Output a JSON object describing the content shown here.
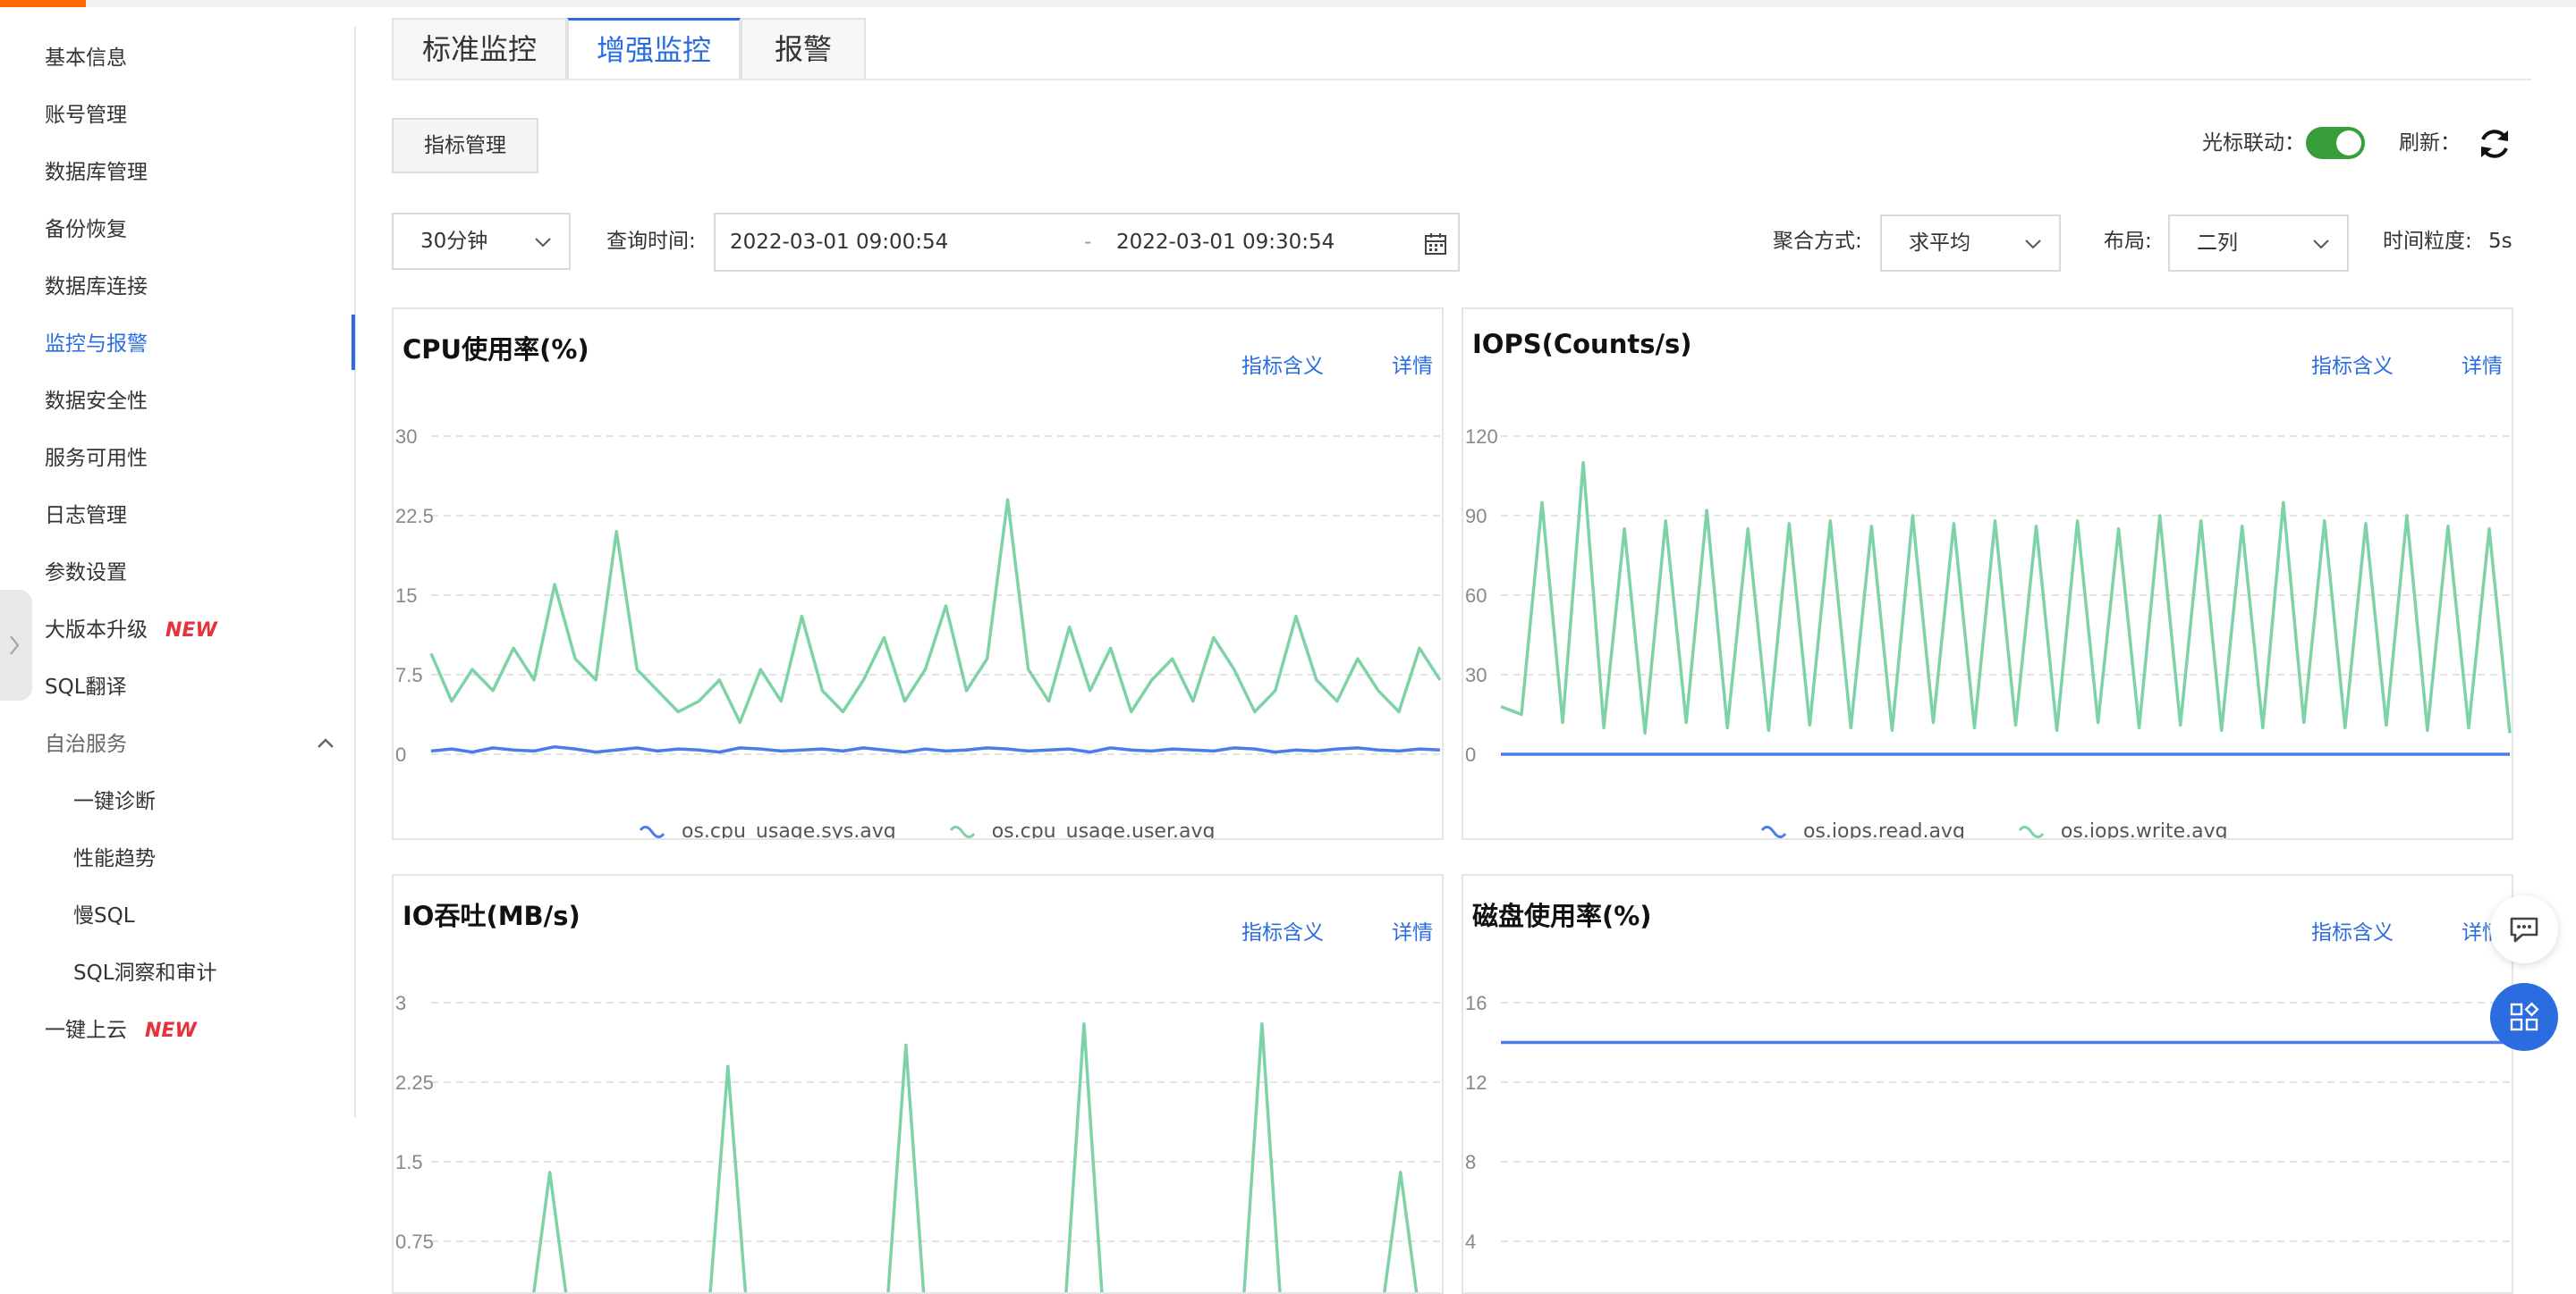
{
  "sidebar": {
    "items": [
      {
        "label": "基本信息"
      },
      {
        "label": "账号管理"
      },
      {
        "label": "数据库管理"
      },
      {
        "label": "备份恢复"
      },
      {
        "label": "数据库连接"
      },
      {
        "label": "监控与报警"
      },
      {
        "label": "数据安全性"
      },
      {
        "label": "服务可用性"
      },
      {
        "label": "日志管理"
      },
      {
        "label": "参数设置"
      },
      {
        "label": "大版本升级",
        "badge": "NEW"
      },
      {
        "label": "SQL翻译"
      },
      {
        "label": "自治服务"
      },
      {
        "label": "一键诊断"
      },
      {
        "label": "性能趋势"
      },
      {
        "label": "慢SQL"
      },
      {
        "label": "SQL洞察和审计"
      },
      {
        "label": "一键上云",
        "badge": "NEW"
      }
    ],
    "active_item": "监控与报警",
    "expanded_icon": "chevron-up-icon"
  },
  "tabs": [
    {
      "label": "标准监控"
    },
    {
      "label": "增强监控"
    },
    {
      "label": "报警"
    }
  ],
  "active_tab": "增强监控",
  "toolbar": {
    "metric_mgmt_label": "指标管理",
    "cursor_link_label": "光标联动：",
    "cursor_link_on": true,
    "refresh_label": "刷新：",
    "range_select": "30分钟",
    "query_time_label": "查询时间:",
    "start_time": "2022-03-01 09:00:54",
    "range_sep": "-",
    "end_time": "2022-03-01 09:30:54",
    "agg_label": "聚合方式:",
    "agg_value": "求平均",
    "layout_label": "布局:",
    "layout_value": "二列",
    "granularity_label": "时间粒度:",
    "granularity_value": "5s"
  },
  "colors": {
    "accent": "#2b6de0",
    "series_blue": "#4a7de8",
    "series_green": "#7dd3a5",
    "toggle_on": "#389e3a",
    "new_badge": "#e8313b",
    "top_accent": "#ff6a00"
  },
  "card_links": {
    "meaning": "指标含义",
    "detail": "详情"
  },
  "chart_data": [
    {
      "type": "line",
      "title": "CPU使用率(%)",
      "ylim": [
        0,
        30
      ],
      "yticks": [
        "0",
        "7.5",
        "15",
        "22.5",
        "30"
      ],
      "grid": true,
      "legend_position": "bottom",
      "series": [
        {
          "name": "os.cpu_usage.sys.avg",
          "color": "#4a7de8",
          "values": [
            0.3,
            0.5,
            0.2,
            0.6,
            0.4,
            0.3,
            0.7,
            0.5,
            0.2,
            0.4,
            0.6,
            0.3,
            0.5,
            0.4,
            0.2,
            0.6,
            0.5,
            0.3,
            0.4,
            0.5,
            0.3,
            0.6,
            0.4,
            0.2,
            0.5,
            0.3,
            0.4,
            0.6,
            0.5,
            0.3,
            0.4,
            0.5,
            0.2,
            0.6,
            0.4,
            0.3,
            0.5,
            0.4,
            0.3,
            0.6,
            0.5,
            0.2,
            0.4,
            0.3,
            0.5,
            0.6,
            0.4,
            0.3,
            0.5,
            0.4
          ]
        },
        {
          "name": "os.cpu_usage.user.avg",
          "color": "#7dd3a5",
          "values": [
            9.5,
            5,
            8,
            6,
            10,
            7,
            16,
            9,
            7,
            21,
            8,
            6,
            4,
            5,
            7,
            3,
            8,
            5,
            13,
            6,
            4,
            7,
            11,
            5,
            8,
            14,
            6,
            9,
            24,
            8,
            5,
            12,
            6,
            10,
            4,
            7,
            9,
            5,
            11,
            8,
            4,
            6,
            13,
            7,
            5,
            9,
            6,
            4,
            10,
            7
          ]
        }
      ]
    },
    {
      "type": "line",
      "title": "IOPS(Counts/s)",
      "ylim": [
        0,
        120
      ],
      "yticks": [
        "0",
        "30",
        "60",
        "90",
        "120"
      ],
      "grid": true,
      "legend_position": "bottom",
      "series": [
        {
          "name": "os.iops.read.avg",
          "color": "#4a7de8",
          "values": [
            0,
            0,
            0,
            0,
            0,
            0,
            0,
            0,
            0,
            0,
            0,
            0,
            0,
            0,
            0,
            0,
            0,
            0,
            0,
            0,
            0,
            0,
            0,
            0,
            0,
            0,
            0,
            0,
            0,
            0,
            0,
            0,
            0,
            0,
            0,
            0,
            0,
            0,
            0,
            0,
            0,
            0,
            0,
            0,
            0,
            0,
            0,
            0,
            0,
            0
          ]
        },
        {
          "name": "os.iops.write.avg",
          "color": "#7dd3a5",
          "values": [
            18,
            15,
            95,
            12,
            110,
            10,
            85,
            8,
            88,
            12,
            92,
            10,
            85,
            9,
            87,
            11,
            88,
            10,
            86,
            9,
            90,
            12,
            87,
            10,
            88,
            11,
            86,
            9,
            88,
            12,
            85,
            10,
            90,
            11,
            88,
            9,
            86,
            10,
            95,
            12,
            88,
            10,
            87,
            11,
            90,
            9,
            86,
            10,
            85,
            8
          ]
        }
      ]
    },
    {
      "type": "line",
      "title": "IO吞吐(MB/s)",
      "ylim": [
        0,
        3
      ],
      "yticks": [
        "0.75",
        "1.5",
        "2.25",
        "3"
      ],
      "grid": true,
      "series": [
        {
          "name": "",
          "color": "#7dd3a5",
          "values": [
            0,
            0,
            0,
            0,
            0,
            0,
            1.4,
            0,
            0,
            0,
            0,
            0,
            0,
            0,
            0,
            2.4,
            0,
            0,
            0,
            0,
            0,
            0,
            0,
            0,
            2.6,
            0,
            0,
            0,
            0,
            0,
            0,
            0,
            0,
            2.8,
            0,
            0,
            0,
            0,
            0,
            0,
            0,
            0,
            2.8,
            0,
            0,
            0.1,
            0,
            0,
            0,
            1.4,
            0,
            0
          ]
        }
      ]
    },
    {
      "type": "line",
      "title": "磁盘使用率(%)",
      "ylim": [
        0,
        16
      ],
      "yticks": [
        "4",
        "8",
        "12",
        "16"
      ],
      "grid": true,
      "series": [
        {
          "name": "",
          "color": "#4a7de8",
          "values": [
            14,
            14,
            14,
            14,
            14,
            14,
            14,
            14,
            14,
            14,
            14,
            14,
            14,
            14,
            14,
            14,
            14,
            14,
            14,
            14
          ]
        }
      ]
    }
  ]
}
